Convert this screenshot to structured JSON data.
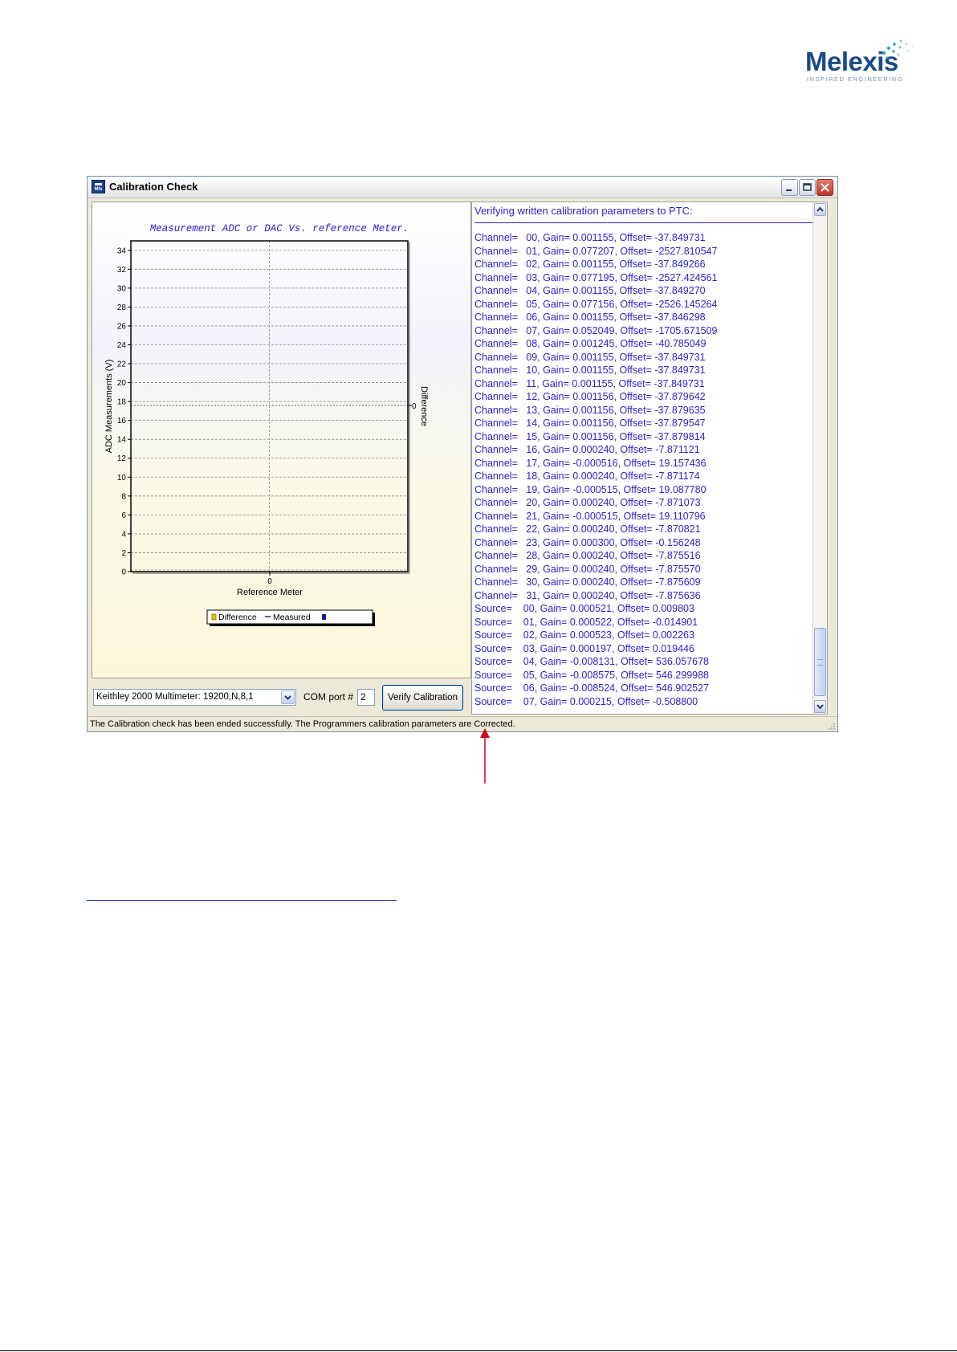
{
  "logo": {
    "word": "Melexis",
    "tagline": "INSPIRED ENGINEERING"
  },
  "window": {
    "title": "Calibration Check",
    "app_icon_text": "Mlx",
    "colors": {
      "log_text": "#2d22cc",
      "chart_title": "#2d22cc",
      "close_button": "#c0382a"
    }
  },
  "chart_data": {
    "type": "line",
    "title": "Measurement ADC or DAC Vs. reference Meter.",
    "xlabel": "Reference Meter",
    "ylabel": "ADC Measurements (V)",
    "y2label": "Difference",
    "x_ticks": [
      "0"
    ],
    "y_ticks": [
      "0",
      "2",
      "4",
      "6",
      "8",
      "10",
      "12",
      "14",
      "16",
      "18",
      "20",
      "22",
      "24",
      "26",
      "28",
      "30",
      "32",
      "34"
    ],
    "y2_ticks": [
      "0"
    ],
    "ylim": [
      0,
      35
    ],
    "grid": true,
    "legend": {
      "placement": "bottom-center",
      "entries": [
        "Difference",
        "Measured"
      ]
    },
    "series": [
      {
        "name": "Difference",
        "values": [],
        "color": "#e8c400"
      },
      {
        "name": "Measured",
        "values": [],
        "color": "#1a1a9a"
      }
    ]
  },
  "log": {
    "header": "Verifying written calibration parameters to PTC:",
    "lines": [
      "Channel=   00, Gain= 0.001155, Offset= -37.849731",
      "Channel=   01, Gain= 0.077207, Offset= -2527.810547",
      "Channel=   02, Gain= 0.001155, Offset= -37.849266",
      "Channel=   03, Gain= 0.077195, Offset= -2527.424561",
      "Channel=   04, Gain= 0.001155, Offset= -37.849270",
      "Channel=   05, Gain= 0.077156, Offset= -2526.145264",
      "Channel=   06, Gain= 0.001155, Offset= -37.846298",
      "Channel=   07, Gain= 0.052049, Offset= -1705.671509",
      "Channel=   08, Gain= 0.001245, Offset= -40.785049",
      "Channel=   09, Gain= 0.001155, Offset= -37.849731",
      "Channel=   10, Gain= 0.001155, Offset= -37.849731",
      "Channel=   11, Gain= 0.001155, Offset= -37.849731",
      "Channel=   12, Gain= 0.001156, Offset= -37.879642",
      "Channel=   13, Gain= 0.001156, Offset= -37.879635",
      "Channel=   14, Gain= 0.001156, Offset= -37.879547",
      "Channel=   15, Gain= 0.001156, Offset= -37.879814",
      "Channel=   16, Gain= 0.000240, Offset= -7.871121",
      "Channel=   17, Gain= -0.000516, Offset= 19.157436",
      "Channel=   18, Gain= 0.000240, Offset= -7.871174",
      "Channel=   19, Gain= -0.000515, Offset= 19.087780",
      "Channel=   20, Gain= 0.000240, Offset= -7.871073",
      "Channel=   21, Gain= -0.000515, Offset= 19.110796",
      "Channel=   22, Gain= 0.000240, Offset= -7.870821",
      "Channel=   23, Gain= 0.000300, Offset= -0.156248",
      "Channel=   28, Gain= 0.000240, Offset= -7.875516",
      "Channel=   29, Gain= 0.000240, Offset= -7.875570",
      "Channel=   30, Gain= 0.000240, Offset= -7.875609",
      "Channel=   31, Gain= 0.000240, Offset= -7.875636",
      "Source=    00, Gain= 0.000521, Offset= 0.009803",
      "Source=    01, Gain= 0.000522, Offset= -0.014901",
      "Source=    02, Gain= 0.000523, Offset= 0.002263",
      "Source=    03, Gain= 0.000197, Offset= 0.019446",
      "Source=    04, Gain= -0.008131, Offset= 536.057678",
      "Source=    05, Gain= -0.008575, Offset= 546.299988",
      "Source=    06, Gain= -0.008524, Offset= 546.902527",
      "Source=    07, Gain= 0.000215, Offset= -0.508800"
    ]
  },
  "controls": {
    "device": "Keithley 2000 Multimeter: 19200,N,8,1",
    "com_label": "COM port #",
    "com_value": "2",
    "verify_label": "Verify Calibration"
  },
  "status": "The Calibration check has been ended successfully. The Programmers calibration parameters are Corrected.",
  "icons": [
    "app-icon",
    "minimize-icon",
    "maximize-icon",
    "close-icon",
    "chevron-down-icon",
    "scroll-up-icon",
    "scroll-down-icon",
    "annotation-arrow-icon"
  ]
}
